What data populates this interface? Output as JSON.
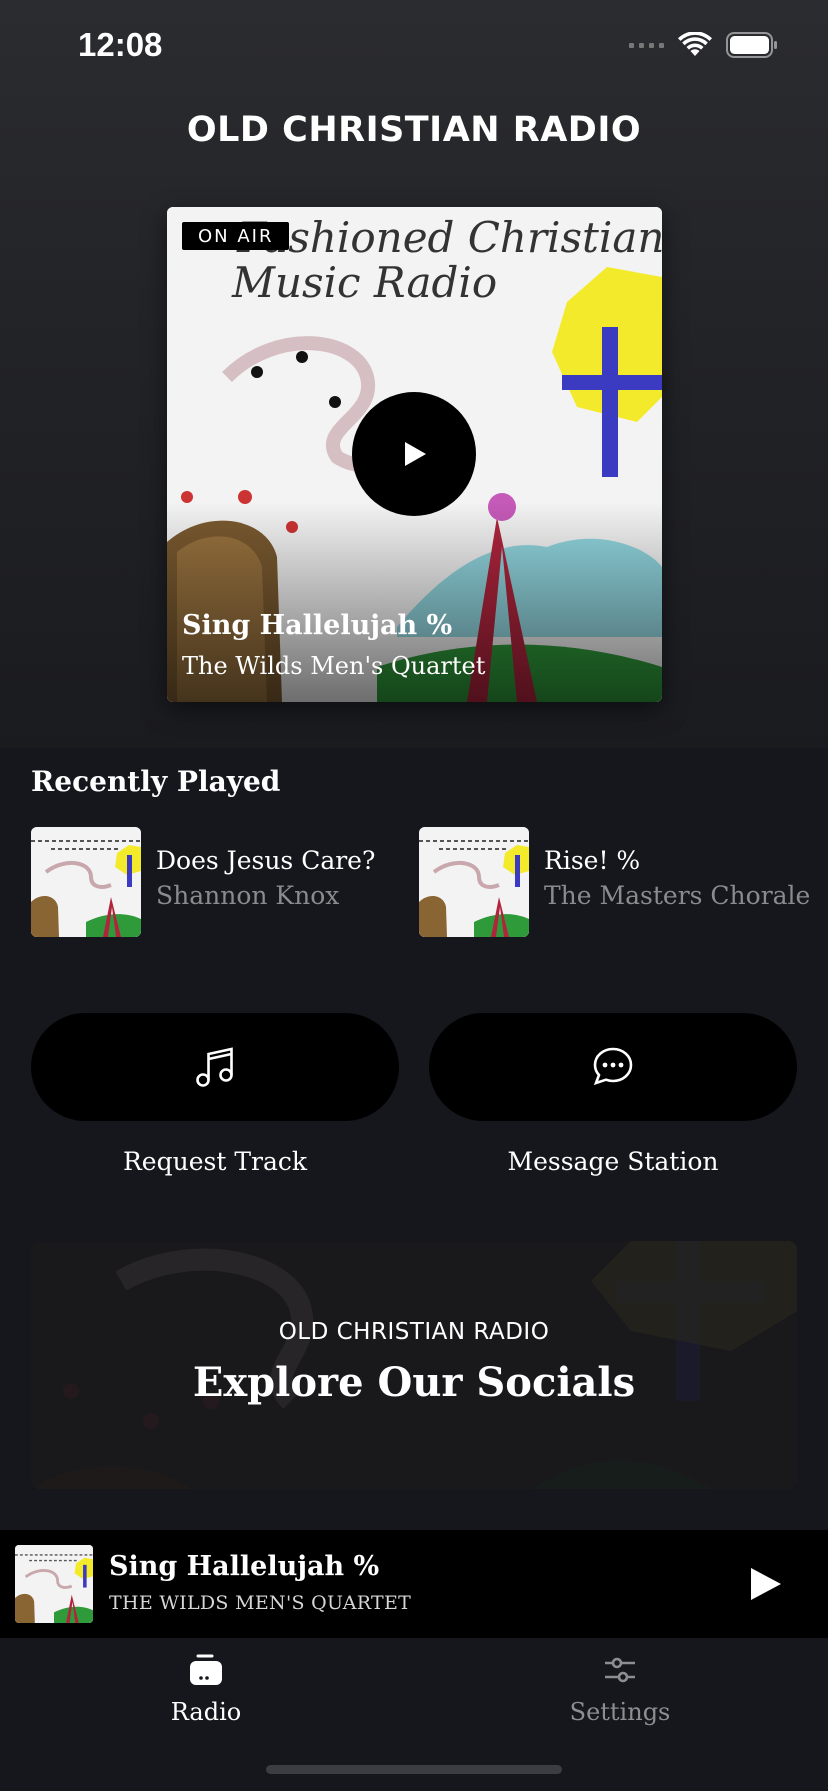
{
  "status_bar": {
    "time": "12:08",
    "icons": [
      "cellular-icon",
      "wifi-icon",
      "battery-icon"
    ]
  },
  "app": {
    "title": "OLD CHRISTIAN RADIO"
  },
  "now_playing": {
    "badge": "ON AIR",
    "title": "Sing Hallelujah %",
    "artist": "The Wilds Men's Quartet",
    "artwork_lines": [
      "Fashioned Christian",
      "Music Radio"
    ]
  },
  "recently_played": {
    "heading": "Recently Played",
    "items": [
      {
        "title": "Does Jesus Care?",
        "artist": "Shannon Knox"
      },
      {
        "title": "Rise! %",
        "artist": "The Masters Chorale"
      }
    ]
  },
  "actions": {
    "request_label": "Request Track",
    "message_label": "Message Station"
  },
  "socials": {
    "eyebrow": "OLD CHRISTIAN RADIO",
    "title": "Explore Our Socials"
  },
  "mini_player": {
    "title": "Sing Hallelujah %",
    "artist": "THE WILDS MEN'S QUARTET"
  },
  "tabs": [
    {
      "label": "Radio",
      "active": true,
      "icon": "radio-icon"
    },
    {
      "label": "Settings",
      "active": false,
      "icon": "sliders-icon"
    }
  ],
  "colors": {
    "background": "#15171c",
    "muted_text": "#8a8b8f",
    "inactive_tab": "#8d8e92",
    "pill": "#000000"
  }
}
